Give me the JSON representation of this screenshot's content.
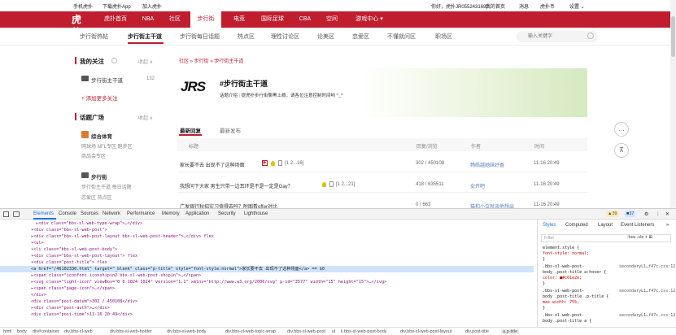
{
  "topbar": {
    "links": [
      "手机虎扑",
      "下载虎扑App",
      "加入虎扑"
    ],
    "user": "你好，虎扑JR0552431692",
    "links_right": [
      "我的首页",
      "消息",
      "虎扑币",
      "设置 ⌄"
    ]
  },
  "logo": "虎扑",
  "nav": [
    "虎扑首页",
    "NBA",
    "社区",
    "步行街",
    "电竞",
    "国际足球",
    "CBA",
    "空间",
    "游戏中心 ▾"
  ],
  "subnav": [
    "步行街热帖",
    "步行街主干道",
    "步行街每日话题",
    "热点区",
    "理性讨论区",
    "论美区",
    "恋爱区",
    "不懂就问区",
    "职场区"
  ],
  "search": {
    "placeholder": "输入关键字"
  },
  "sidebar": {
    "my_follow": "我的关注",
    "collapse": "收起 ∧",
    "main_street": "步行街主干道",
    "main_count": "132",
    "add_follow": "+ 添加更多关注",
    "topic_square": "话题广场",
    "collapse2": "收起 ∧",
    "sports": "综合体育",
    "sports_subs": "网球场   NFL专区   跑步区",
    "sports_sub2": "商品会专区",
    "street": "步行街",
    "street_subs": "步行街主干道   每日话题",
    "street_sub2": "恋爱区   热点区"
  },
  "breadcrumb": "社区 » 步行街 » 步行街主干道",
  "banner": {
    "logo_text": "JRS",
    "title": "#步行街主干道",
    "intro_label": "话题介绍",
    "intro": "提虎扑步行街聊黑上瘾，请各位注意控制时间哟 ^_^"
  },
  "tabs": [
    "最新回复",
    "最新发布"
  ],
  "table": {
    "headers": [
      "标题",
      "回复/浏览",
      "作者",
      "时间"
    ],
    "rows": [
      {
        "title": "家长要不去 出现不了这种场面",
        "pages": "[1 2...16]",
        "stats": "302 / 450108",
        "author": "畅皓越她妹好香",
        "time": "11-16 20:49"
      },
      {
        "title": "我想问下大家 男生只带一边耳环是不是一定是Gay？",
        "pages": "[1 2...21]",
        "stats": "418 / 635511",
        "author": "女开吧",
        "time": "11-16 20:49"
      },
      {
        "title": "广发银行秋招实习值得去吗？附图看offer对比",
        "pages": "",
        "stats": "0 / 663",
        "author": "猫和小议就谈他想出",
        "time": "11-16 20:49"
      }
    ]
  },
  "devtools": {
    "tabs": [
      "Elements",
      "Console",
      "Sources",
      "Network",
      "Performance",
      "Memory",
      "Application",
      "Security",
      "Lighthouse"
    ],
    "warnings": "39",
    "errors": "37",
    "dom_lines": [
      "▸<div class=\"bbs-sl-web-type-wrap\">…</div>",
      "▾<div class=\"bbs-sl-web-post\">",
      "  ▸<div class=\"bbs-sl-web-post-layout bbs-sl-web-post-header\">…</div> flex",
      "  ▾<ul>",
      "    ▾<li class=\"bbs-sl-web-post-body\">",
      "      ▾<div class=\"bbs-sl-web-post-layout\"> flex",
      "        ▾<div class=\"post-title\"> flex",
      "          <a href=\"/46102330.html\" target=\"_blank\" class=\"p-title\" style=\"font-style:normal\">家长要不去 出现不了这种场面</a> == $0",
      "          ▸<span class=\"iconfont iconshipin2 bbs-sl-web-post-shipin\">…</span>",
      "          ▸<svg class=\"light-icon\" viewBox=\"0 0 1024 1024\" version=\"1.1\" xmlns=\"http://www.w3.org/2000/svg\" p-id=\"3577\" width=\"15\" height=\"15\">…</svg>",
      "          ▸<span class=\"page-icon\">…</span>",
      "        </div>",
      "        <div class=\"post-datum\">302 / 450108</div>",
      "        ▸<div class=\"post-auth\">…</div>",
      "        <div class=\"post-time\">11-16 20:49</div>"
    ],
    "styles_tabs": [
      "Styles",
      "Computed",
      "Layout",
      "Event Listeners",
      "»"
    ],
    "filter_placeholder": "Filter",
    "filter_right": ":hov .cls + ⊞",
    "css_lines": [
      "element.style {",
      "  font-style: normal;",
      "}",
      ".bbs-sl-web-post-",
      "body .post-title a:hover {",
      "  color: ■#c01e2e;",
      "}",
      ".bbs-sl-web-post-",
      "body .post-title .p-title {",
      "  max-width: 75%;",
      "}",
      ".bbs-sl-web-post-",
      "body .post-title a {"
    ],
    "css_src": [
      "secondaryL1…f47c.css:12",
      "secondaryL1…f47c.css:12",
      "secondaryL1…f47c.css:12"
    ],
    "breadcrumbs": [
      "html",
      "body",
      "div#container",
      "div.bbs-sl-web",
      "div.bbs-sl-web-holder",
      "div.bbs-sl-web-body",
      "div.bbs-sl-web-topic-wrap",
      "div.bbs-sl-web-post",
      "ul",
      "li.bbs-sl-web-post-body",
      "div.bbs-sl-web-post-layout",
      "div.post-title",
      "a.p-title"
    ]
  }
}
